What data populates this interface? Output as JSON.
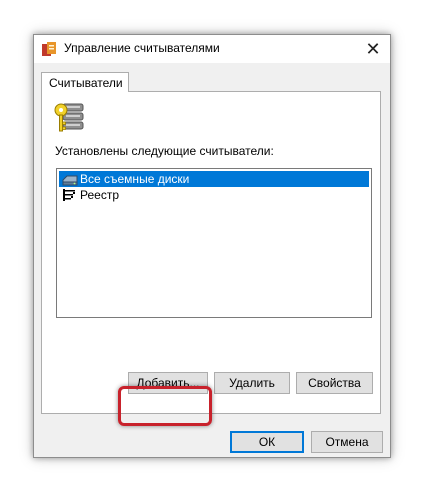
{
  "window": {
    "title": "Управление считывателями",
    "close_symbol": "✕",
    "app_icon": "app-icon",
    "close_icon": "close-icon"
  },
  "tabs": [
    {
      "label": "Считыватели",
      "selected": true
    }
  ],
  "readers_panel": {
    "icon": "key-server-icon",
    "installed_label": "Установлены следующие считыватели:",
    "items": [
      {
        "label": "Все съемные диски",
        "icon": "removable-disk-icon",
        "selected": true
      },
      {
        "label": "Реестр",
        "icon": "registry-icon",
        "selected": false
      }
    ]
  },
  "panel_buttons": {
    "add_label": "Добавить...",
    "remove_label": "Удалить",
    "properties_label": "Свойства"
  },
  "dialog_buttons": {
    "ok_label": "ОК",
    "cancel_label": "Отмена"
  },
  "colors": {
    "selection": "#0078d7",
    "highlight": "#c8222c",
    "dialog_background": "#f0f0f0"
  }
}
